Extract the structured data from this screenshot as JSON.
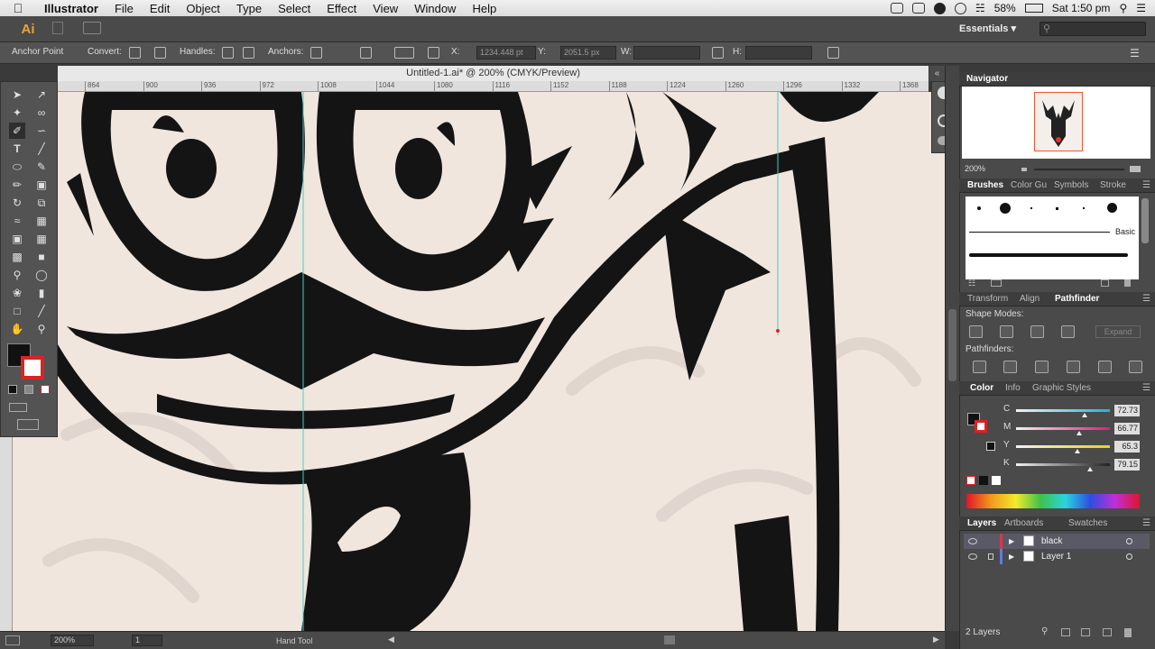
{
  "menubar": {
    "app_name": "Illustrator",
    "items": [
      "File",
      "Edit",
      "Object",
      "Type",
      "Select",
      "Effect",
      "View",
      "Window",
      "Help"
    ],
    "battery": "58%",
    "clock": "Sat 1:50 pm"
  },
  "appbar": {
    "logo": "Ai",
    "workspace": "Essentials"
  },
  "control_bar": {
    "tool_label": "Anchor Point",
    "convert_label": "Convert:",
    "handles_label": "Handles:",
    "anchors_label": "Anchors:",
    "x_label": "X:",
    "x_value": "1234.448 pt",
    "y_label": "Y:",
    "y_value": "2051.5 px",
    "w_label": "W:",
    "h_label": "H:"
  },
  "document": {
    "tab_title": "Untitled-1.ai* @ 200% (CMYK/Preview)",
    "ruler_ticks": [
      "864",
      "900",
      "936",
      "972",
      "1008",
      "1044",
      "1080",
      "1116",
      "1152",
      "1188",
      "1224",
      "1260",
      "1296",
      "1332",
      "1368"
    ],
    "zoom": "200%",
    "artboard_num": "1",
    "status_text": "Hand Tool"
  },
  "navigator": {
    "title": "Navigator",
    "zoom": "200%"
  },
  "brushes_panel": {
    "tabs": [
      "Brushes",
      "Color Gu",
      "Symbols",
      "Stroke"
    ],
    "basic_label": "Basic"
  },
  "pathfinder_panel": {
    "tabs": [
      "Transform",
      "Align",
      "Pathfinder"
    ],
    "shape_modes_label": "Shape Modes:",
    "expand_label": "Expand",
    "pathfinders_label": "Pathfinders:"
  },
  "color_panel": {
    "tabs": [
      "Color",
      "Info",
      "Graphic Styles"
    ],
    "channels": [
      {
        "name": "C",
        "value": "72.73",
        "fraction": 0.73,
        "color": "#1fb3d9"
      },
      {
        "name": "M",
        "value": "66.77",
        "fraction": 0.67,
        "color": "#d9207a"
      },
      {
        "name": "Y",
        "value": "65.3",
        "fraction": 0.65,
        "color": "#e8d020"
      },
      {
        "name": "K",
        "value": "79.15",
        "fraction": 0.79,
        "color": "#222222"
      }
    ]
  },
  "layers_panel": {
    "tabs": [
      "Layers",
      "Artboards",
      "Swatches"
    ],
    "layers": [
      {
        "name": "black",
        "color": "#d9364a",
        "selected": true
      },
      {
        "name": "Layer 1",
        "color": "#5a7de0",
        "selected": false
      }
    ],
    "count": "2 Layers"
  }
}
